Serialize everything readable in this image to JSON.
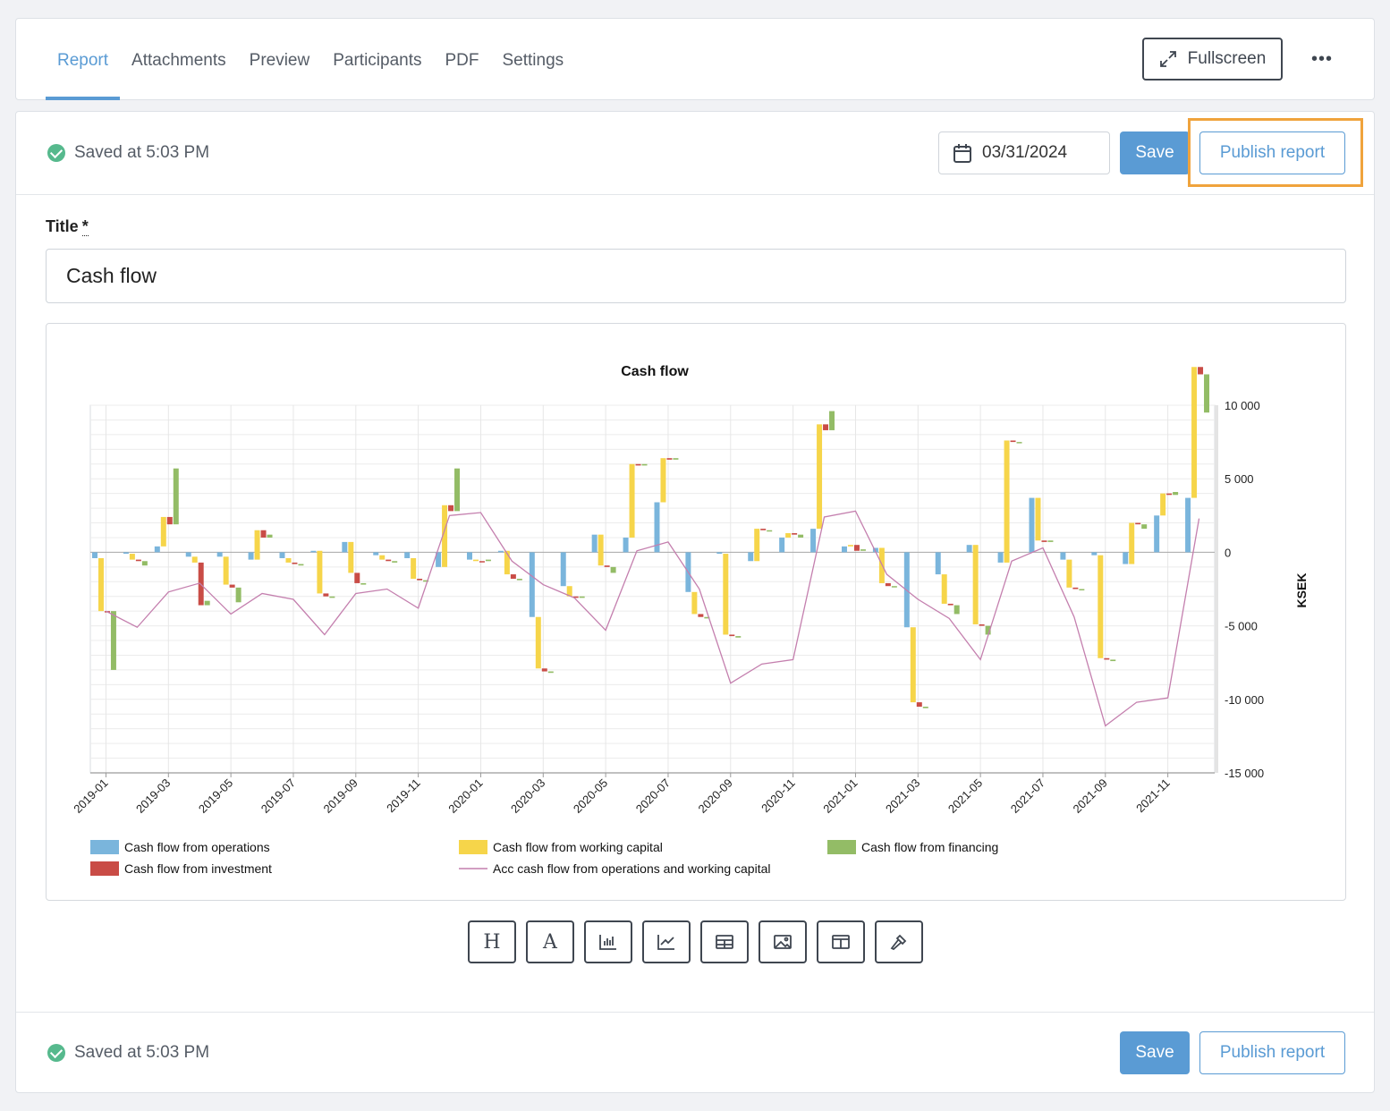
{
  "tabs": [
    "Report",
    "Attachments",
    "Preview",
    "Participants",
    "PDF",
    "Settings"
  ],
  "header": {
    "fullscreen_label": "Fullscreen",
    "more_label": "•••"
  },
  "toolbar_top": {
    "saved_text": "Saved at 5:03 PM",
    "date_value": "03/31/2024",
    "save_label": "Save",
    "publish_label": "Publish report"
  },
  "form": {
    "title_label": "Title",
    "required_mark": "*",
    "title_value": "Cash flow"
  },
  "insert_tools": [
    "H",
    "A",
    "bar-chart-icon",
    "line-chart-icon",
    "table-icon",
    "image-icon",
    "layout-icon",
    "hammer-icon"
  ],
  "toolbar_bottom": {
    "saved_text": "Saved at 5:03 PM",
    "save_label": "Save",
    "publish_label": "Publish report"
  },
  "chart_data": {
    "type": "bar",
    "title": "Cash flow",
    "ylabel": "KSEK",
    "ylim": [
      -15000,
      10000
    ],
    "yticks": [
      10000,
      5000,
      0,
      -5000,
      -10000,
      -15000
    ],
    "ytick_labels": [
      "10 000",
      "5 000",
      "0",
      "-5 000",
      "-10 000",
      "-15 000"
    ],
    "xtick_labels": [
      "2019-01",
      "2019-03",
      "2019-05",
      "2019-07",
      "2019-09",
      "2019-11",
      "2020-01",
      "2020-03",
      "2020-05",
      "2020-07",
      "2020-09",
      "2020-11",
      "2021-01",
      "2021-03",
      "2021-05",
      "2021-07",
      "2021-09",
      "2021-11"
    ],
    "categories": [
      "2019-01",
      "2019-02",
      "2019-03",
      "2019-04",
      "2019-05",
      "2019-06",
      "2019-07",
      "2019-08",
      "2019-09",
      "2019-10",
      "2019-11",
      "2019-12",
      "2020-01",
      "2020-02",
      "2020-03",
      "2020-04",
      "2020-05",
      "2020-06",
      "2020-07",
      "2020-08",
      "2020-09",
      "2020-10",
      "2020-11",
      "2020-12",
      "2021-01",
      "2021-02",
      "2021-03",
      "2021-04",
      "2021-05",
      "2021-06",
      "2021-07",
      "2021-08",
      "2021-09",
      "2021-10",
      "2021-11",
      "2021-12"
    ],
    "series": [
      {
        "name": "Cash flow from operations",
        "color": "#7ab5dc",
        "kind": "waterfall",
        "values": [
          -400,
          -100,
          400,
          -300,
          -300,
          -500,
          -400,
          100,
          700,
          -200,
          -400,
          -1000,
          -500,
          100,
          -4400,
          -2300,
          1200,
          1000,
          3400,
          -2700,
          -100,
          -600,
          1000,
          1600,
          400,
          300,
          -5100,
          -1500,
          500,
          -700,
          3700,
          -500,
          -200,
          -800,
          2500,
          3700
        ]
      },
      {
        "name": "Cash flow from working capital",
        "color": "#f6d54a",
        "kind": "waterfall",
        "values": [
          -3600,
          -400,
          2000,
          -400,
          -1900,
          2000,
          -300,
          -2900,
          -2100,
          -300,
          -1400,
          4200,
          -100,
          -1600,
          -3500,
          -700,
          -2100,
          5000,
          3000,
          -1500,
          -5500,
          2200,
          300,
          7100,
          100,
          -2400,
          -5100,
          -2000,
          -5400,
          8300,
          -2900,
          -1900,
          -7000,
          2800,
          1500,
          8900
        ]
      },
      {
        "name": "Cash flow from financing",
        "color": "#93bc66",
        "kind": "waterfall",
        "values": [
          -4000,
          -300,
          3800,
          300,
          -1000,
          200,
          -100,
          -100,
          -100,
          -100,
          -100,
          2900,
          100,
          -100,
          -100,
          100,
          -400,
          100,
          100,
          -100,
          -100,
          0,
          -200,
          1300,
          100,
          0,
          -100,
          -600,
          -600,
          0,
          100,
          0,
          -100,
          -300,
          200,
          -2600
        ]
      },
      {
        "name": "Cash flow from investment",
        "color": "#c94c46",
        "kind": "waterfall",
        "values": [
          0,
          -100,
          -500,
          -2900,
          -200,
          -500,
          -100,
          -200,
          -700,
          -100,
          -100,
          -400,
          0,
          -300,
          -200,
          -100,
          -100,
          -100,
          -100,
          -200,
          -100,
          -100,
          -100,
          -400,
          -400,
          -200,
          -300,
          -100,
          -100,
          -100,
          -100,
          -100,
          -100,
          -100,
          -100,
          -500
        ]
      },
      {
        "name": "Acc cash flow from operations and working capital",
        "color": "#c47fae",
        "kind": "line",
        "values": [
          -4000,
          -5100,
          -2700,
          -2100,
          -4200,
          -2800,
          -3200,
          -5600,
          -2800,
          -2500,
          -3800,
          2500,
          2700,
          -600,
          -2200,
          -3100,
          -5300,
          100,
          700,
          -2500,
          -8900,
          -7600,
          -7300,
          2400,
          2800,
          -1500,
          -3200,
          -4500,
          -7300,
          -600,
          300,
          -4400,
          -11800,
          -10200,
          -9900,
          2300
        ]
      }
    ],
    "legend": "bottom"
  }
}
